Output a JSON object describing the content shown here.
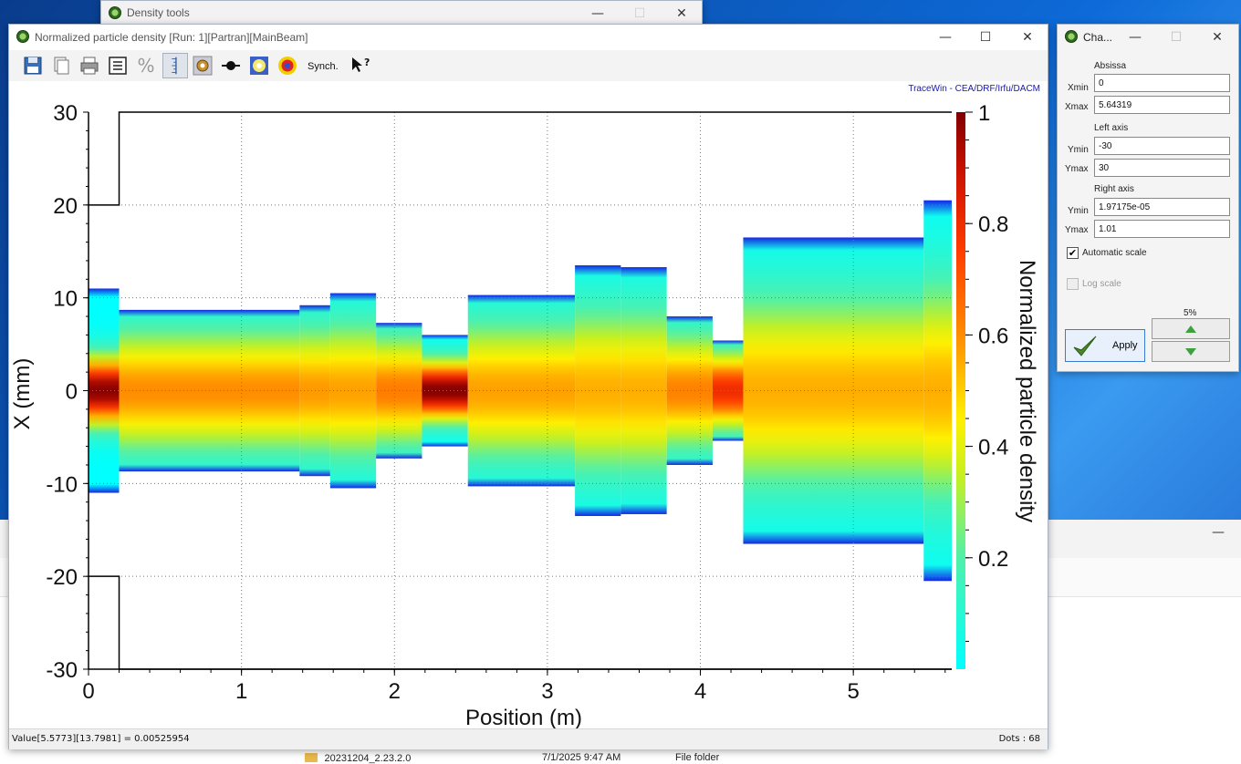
{
  "density_tools": {
    "title": "Density tools"
  },
  "main_window": {
    "title": "Normalized particle density [Run: 1][Partran][MainBeam]",
    "synch_label": "Synch.",
    "credit": "TraceWin - CEA/DRF/Irfu/DACM",
    "status_value": "Value[5.5773][13.7981] = 0.00525954",
    "status_dots": "Dots : 68"
  },
  "chart_window": {
    "title": "Cha...",
    "abscissa_label": "Absissa",
    "xmin_label": "Xmin",
    "xmin_value": "0",
    "xmax_label": "Xmax",
    "xmax_value": "5.64319",
    "left_axis_label": "Left axis",
    "ymin_left_label": "Ymin",
    "ymin_left_value": "-30",
    "ymax_left_label": "Ymax",
    "ymax_left_value": "30",
    "right_axis_label": "Right axis",
    "ymin_right_label": "Ymin",
    "ymin_right_value": "1.97175e-05",
    "ymax_right_label": "Ymax",
    "ymax_right_value": "1.01",
    "auto_scale_label": "Automatic scale",
    "auto_scale_checked": true,
    "log_scale_label": "Log scale",
    "log_scale_checked": false,
    "apply_label": "Apply",
    "step_label": "5%"
  },
  "explorer": {
    "folder_name": "20231204_2.23.2.0",
    "folder_date": "7/1/2025 9:47 AM",
    "folder_type": "File folder"
  },
  "chart_data": {
    "type": "heatmap",
    "xlabel": "Position (m)",
    "ylabel": "X (mm)",
    "colorbar_label": "Normalized particle density",
    "xlim": [
      0,
      5.64319
    ],
    "ylim": [
      -30,
      30
    ],
    "x_ticks": [
      0,
      1,
      2,
      3,
      4,
      5
    ],
    "y_ticks": [
      30,
      20,
      10,
      0,
      -10,
      -20,
      -30
    ],
    "colorbar_range": [
      0,
      1
    ],
    "colorbar_ticks": [
      1,
      0.8,
      0.6,
      0.4,
      0.2
    ],
    "grid": true,
    "aperture": {
      "segments": [
        {
          "x": [
            0,
            0.2
          ],
          "half_width": 20
        },
        {
          "x": [
            0.2,
            5.64319
          ],
          "half_width": 30
        }
      ]
    },
    "segments": [
      {
        "x0": 0.0,
        "x1": 0.2,
        "half_width": 11.0,
        "core": 2.5,
        "peak": 1.0
      },
      {
        "x0": 0.2,
        "x1": 1.38,
        "half_width": 8.7,
        "core": 4.5,
        "peak": 0.6
      },
      {
        "x0": 1.38,
        "x1": 1.58,
        "half_width": 9.2,
        "core": 4.7,
        "peak": 0.58
      },
      {
        "x0": 1.58,
        "x1": 1.88,
        "half_width": 10.5,
        "core": 5.0,
        "peak": 0.57
      },
      {
        "x0": 1.88,
        "x1": 2.18,
        "half_width": 7.3,
        "core": 4.0,
        "peak": 0.63
      },
      {
        "x0": 2.18,
        "x1": 2.48,
        "half_width": 6.0,
        "core": 2.2,
        "peak": 1.0
      },
      {
        "x0": 2.48,
        "x1": 3.18,
        "half_width": 10.3,
        "core": 5.0,
        "peak": 0.57
      },
      {
        "x0": 3.18,
        "x1": 3.48,
        "half_width": 13.5,
        "core": 6.0,
        "peak": 0.55
      },
      {
        "x0": 3.48,
        "x1": 3.78,
        "half_width": 13.3,
        "core": 6.0,
        "peak": 0.55
      },
      {
        "x0": 3.78,
        "x1": 4.08,
        "half_width": 8.0,
        "core": 4.2,
        "peak": 0.62
      },
      {
        "x0": 4.08,
        "x1": 4.28,
        "half_width": 5.4,
        "core": 2.8,
        "peak": 0.8
      },
      {
        "x0": 4.28,
        "x1": 5.46,
        "half_width": 16.5,
        "core": 7.0,
        "peak": 0.55
      },
      {
        "x0": 5.46,
        "x1": 5.66,
        "half_width": 20.5,
        "core": 8.0,
        "peak": 0.55
      }
    ]
  }
}
